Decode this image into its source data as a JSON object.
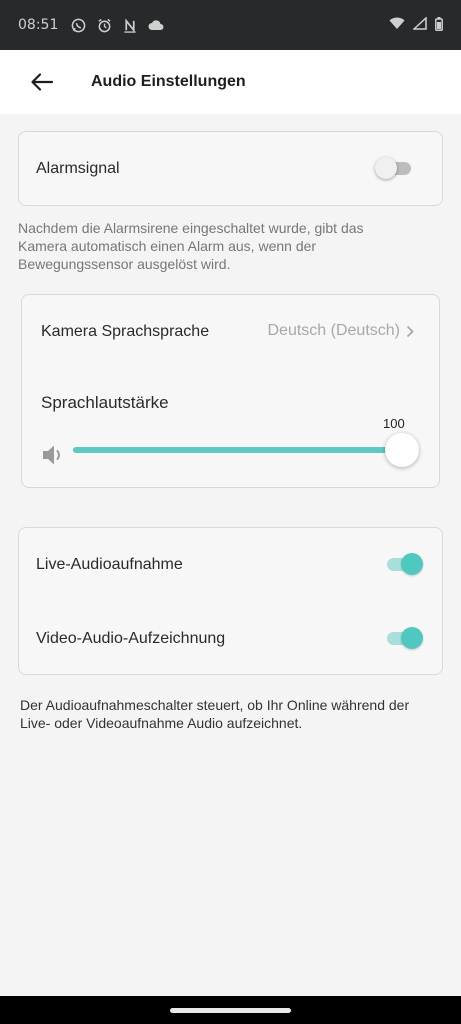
{
  "status_bar": {
    "time": "08:51",
    "icons": [
      "whatsapp-icon",
      "alarm-clock-icon",
      "nfc-icon",
      "cloud-icon"
    ],
    "right_icons": [
      "wifi-icon",
      "signal-icon",
      "battery-icon"
    ]
  },
  "app_bar": {
    "title": "Audio Einstellungen"
  },
  "alarm": {
    "label": "Alarmsignal",
    "enabled": false,
    "description": "Nachdem die Alarmsirene eingeschaltet wurde, gibt das Kamera automatisch einen Alarm aus, wenn der Bewegungssensor ausgelöst wird."
  },
  "voice": {
    "language_label": "Kamera Sprachsprache",
    "language_value": "Deutsch (Deutsch)",
    "volume_label": "Sprachlautstärke",
    "volume_value": "100",
    "volume_fraction": 1.0
  },
  "recording": {
    "live_label": "Live-Audioaufnahme",
    "live_enabled": true,
    "video_label": "Video-Audio-Aufzeichnung",
    "video_enabled": true,
    "description": "Der Audioaufnahmeschalter steuert, ob Ihr Online während der Live- oder Videoaufnahme Audio aufzeichnet."
  },
  "colors": {
    "accent": "#4fc9c0",
    "status_bar": "#272a2b"
  }
}
